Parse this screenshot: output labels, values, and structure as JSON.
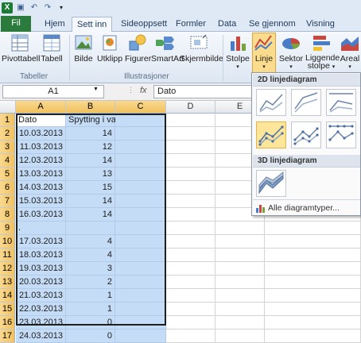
{
  "quick_access": {
    "logo": "X",
    "save": "💾",
    "undo": "↶",
    "redo": "↷"
  },
  "tabs": [
    {
      "label": "Fil"
    },
    {
      "label": "Hjem"
    },
    {
      "label": "Sett inn"
    },
    {
      "label": "Sideoppsett"
    },
    {
      "label": "Formler"
    },
    {
      "label": "Data"
    },
    {
      "label": "Se gjennom"
    },
    {
      "label": "Visning"
    }
  ],
  "ribbon": {
    "pivot": "Pivottabell",
    "table": "Tabell",
    "tables_group": "Tabeller",
    "image": "Bilde",
    "clipart": "Utklipp",
    "shapes": "Figurer",
    "smartart": "SmartArt",
    "screenshot": "Skjermbilde",
    "illustrations_group": "Illustrasjoner",
    "column": "Stolpe",
    "line": "Linje",
    "pie": "Sektor",
    "bar_line1": "Liggende",
    "bar_line2": "stolpe",
    "area": "Areal"
  },
  "formula_bar": {
    "name_box": "A1",
    "fx": "fx",
    "content": "Dato"
  },
  "columns": [
    "A",
    "B",
    "C",
    "D",
    "E"
  ],
  "rows": [
    {
      "n": "1",
      "a": "Dato",
      "b": "Spytting i vaktskifter"
    },
    {
      "n": "2",
      "a": "10.03.2013",
      "b": "14"
    },
    {
      "n": "3",
      "a": "11.03.2013",
      "b": "12"
    },
    {
      "n": "4",
      "a": "12.03.2013",
      "b": "14"
    },
    {
      "n": "5",
      "a": "13.03.2013",
      "b": "13"
    },
    {
      "n": "6",
      "a": "14.03.2013",
      "b": "15"
    },
    {
      "n": "7",
      "a": "15.03.2013",
      "b": "14"
    },
    {
      "n": "8",
      "a": "16.03.2013",
      "b": "14"
    },
    {
      "n": "9",
      "a": ".",
      "b": ""
    },
    {
      "n": "10",
      "a": "17.03.2013",
      "b": "4"
    },
    {
      "n": "11",
      "a": "18.03.2013",
      "b": "4"
    },
    {
      "n": "12",
      "a": "19.03.2013",
      "b": "3"
    },
    {
      "n": "13",
      "a": "20.03.2013",
      "b": "2"
    },
    {
      "n": "14",
      "a": "21.03.2013",
      "b": "1"
    },
    {
      "n": "15",
      "a": "22.03.2013",
      "b": "1"
    },
    {
      "n": "16",
      "a": "23.03.2013",
      "b": "0"
    },
    {
      "n": "17",
      "a": "24.03.2013",
      "b": "0"
    }
  ],
  "dropdown": {
    "section_2d": "2D linjediagram",
    "section_3d": "3D linjediagram",
    "all_types": "Alle diagramtyper..."
  }
}
